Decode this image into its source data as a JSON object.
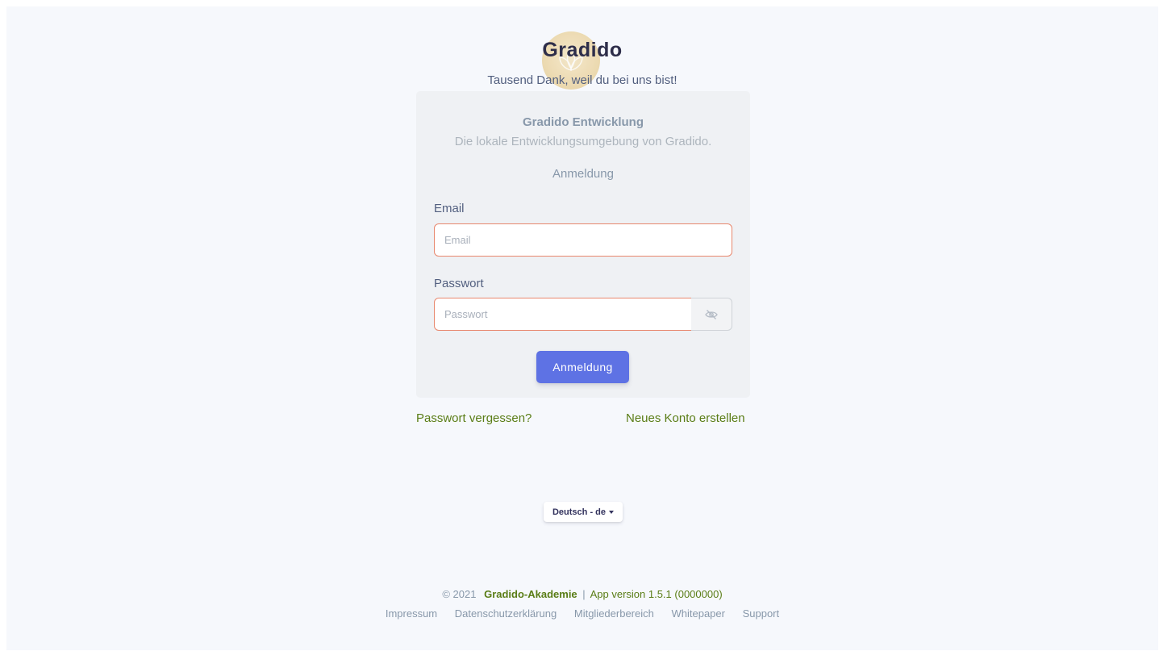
{
  "header": {
    "brand": "Gradido",
    "tagline": "Tausend Dank, weil du bei uns bist!"
  },
  "card": {
    "community_name": "Gradido Entwicklung",
    "community_description": "Die lokale Entwicklungsumgebung von Gradido.",
    "heading": "Anmeldung",
    "email_label": "Email",
    "email_placeholder": "Email",
    "email_value": "",
    "password_label": "Passwort",
    "password_placeholder": "Passwort",
    "password_value": "",
    "toggle_icon": "eye-slash-icon",
    "submit_label": "Anmeldung"
  },
  "links": {
    "forgot_password": "Passwort vergessen?",
    "register": "Neues Konto erstellen"
  },
  "language": {
    "selected": "Deutsch - de"
  },
  "footer": {
    "copyright": "© 2021",
    "company": "Gradido-Akademie",
    "separator": "|",
    "version": "App version 1.5.1 (0000000)",
    "nav": [
      "Impressum",
      "Datenschutzerklärung",
      "Mitgliederbereich",
      "Whitepaper",
      "Support"
    ]
  },
  "colors": {
    "primary_button": "#5e72e4",
    "link_green": "#5a7d16",
    "input_border_invalid": "#e8876d",
    "background": "#f6f8fc"
  }
}
